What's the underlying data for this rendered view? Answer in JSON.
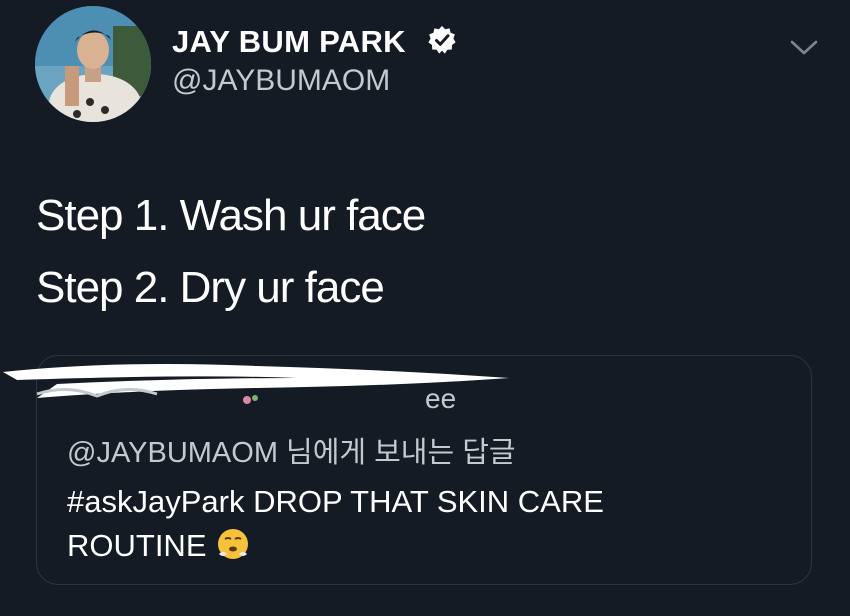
{
  "user": {
    "display_name": "JAY BUM PARK",
    "handle": "@JAYBUMAOM",
    "verified": true,
    "verified_icon": "verified-badge-icon"
  },
  "menu_icon": "chevron-down-icon",
  "tweet": {
    "lines": [
      "Step 1. Wash ur face",
      "Step 2. Dry ur face"
    ]
  },
  "quoted": {
    "name_partial": "ee",
    "reply_to": "@JAYBUMAOM 님에게 보내는 답글",
    "text": "#askJayPark DROP THAT SKIN CARE ROUTINE",
    "emoji": "face-with-steam-from-nose-emoji"
  },
  "colors": {
    "background": "#141b24",
    "text": "#ffffff",
    "muted": "#c3c9cf",
    "border": "#2d3742"
  }
}
